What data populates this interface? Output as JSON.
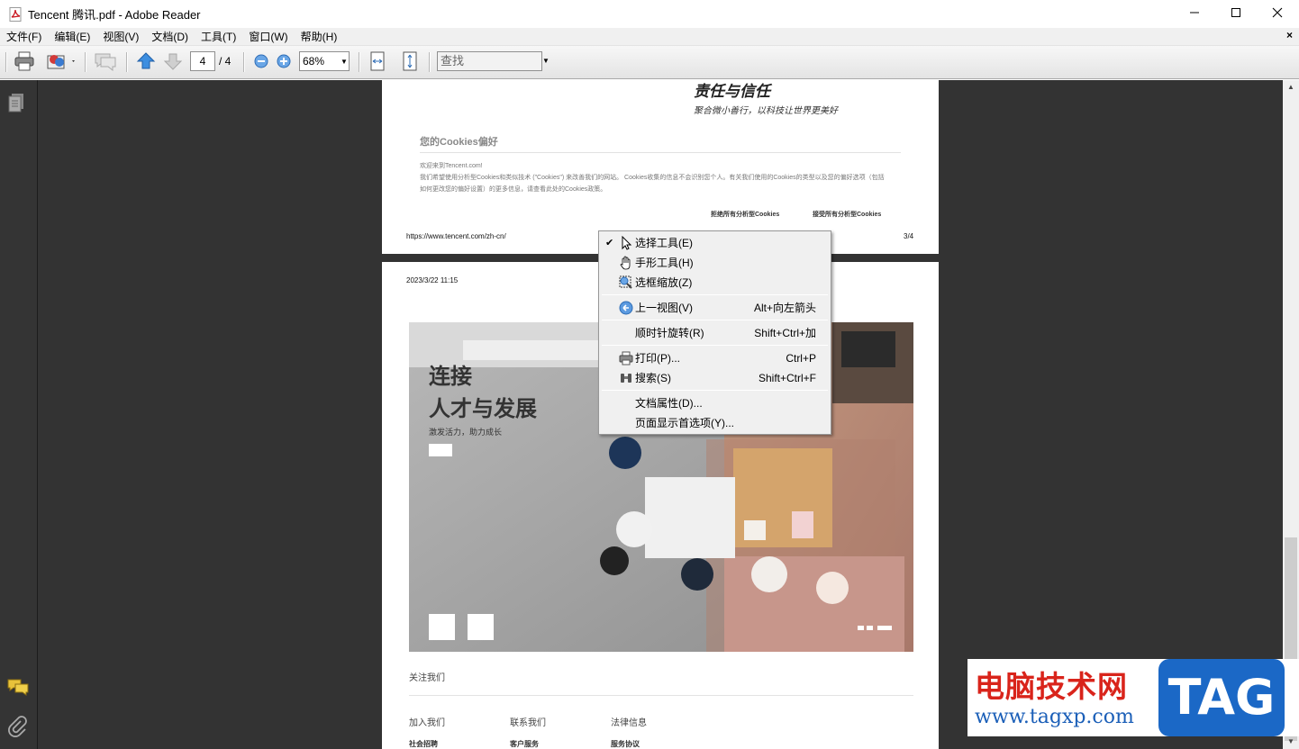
{
  "window": {
    "title": "Tencent 腾讯.pdf - Adobe Reader",
    "icon": "pdf-file-icon",
    "controls": [
      "minimize-icon",
      "maximize-icon",
      "close-icon"
    ]
  },
  "menubar": {
    "items": [
      "文件(F)",
      "编辑(E)",
      "视图(V)",
      "文档(D)",
      "工具(T)",
      "窗口(W)",
      "帮助(H)"
    ],
    "close_doc": "×"
  },
  "toolbar": {
    "current_page": "4",
    "total_pages": "/ 4",
    "zoom": "68%",
    "find_placeholder": "查找",
    "buttons": [
      "print-icon",
      "email-icon",
      "comment-icon",
      "previous-page-icon",
      "next-page-icon",
      "zoom-out-icon",
      "zoom-in-icon",
      "fit-width-icon",
      "fit-page-icon"
    ]
  },
  "leftnav": {
    "icons": [
      "pages-icon",
      "comments-icon",
      "attachments-icon"
    ]
  },
  "page3": {
    "heading": "责任与信任",
    "subheading": "聚合微小善行，以科技让世界更美好",
    "cookie_title": "您的Cookies偏好",
    "cookie_line1": "欢迎来到Tencent.com!",
    "cookie_line2": "我们希望使用分析型Cookies和类似技术 (\"Cookies\") 来改善我们的网站。 Cookies收集的信息不会识别您个人。有关我们使用的Cookies的类型以及您的偏好选项（包括",
    "cookie_line3": "如何更改您的偏好设置）的更多信息，请查看此处的Cookies政策。",
    "reject_btn": "拒绝所有分析型Cookies",
    "accept_btn": "接受所有分析型Cookies",
    "url": "https://www.tencent.com/zh-cn/",
    "page_num": "3/4"
  },
  "page4": {
    "date": "2023/3/22 11:15",
    "hero_line1": "连接",
    "hero_line2": "人才与发展",
    "hero_sub": "激发活力，助力成长",
    "follow": "关注我们",
    "links_col1": "加入我们",
    "links_col2": "联系我们",
    "links_col3": "法律信息",
    "sub_col1": "社会招聘",
    "sub_col2": "客户服务",
    "sub_col3": "服务协议"
  },
  "context_menu": {
    "items": [
      {
        "label": "选择工具(E)",
        "shortcut": "",
        "icon": "arrow-cursor-icon",
        "checked": true
      },
      {
        "label": "手形工具(H)",
        "shortcut": "",
        "icon": "hand-icon",
        "checked": false
      },
      {
        "label": "选框缩放(Z)",
        "shortcut": "",
        "icon": "marquee-zoom-icon",
        "checked": false
      },
      {
        "label": "上一视图(V)",
        "shortcut": "Alt+向左箭头",
        "icon": "previous-view-icon",
        "checked": false
      },
      {
        "label": "顺时针旋转(R)",
        "shortcut": "Shift+Ctrl+加",
        "icon": "",
        "checked": false
      },
      {
        "label": "打印(P)...",
        "shortcut": "Ctrl+P",
        "icon": "print-icon",
        "checked": false
      },
      {
        "label": "搜索(S)",
        "shortcut": "Shift+Ctrl+F",
        "icon": "binoculars-icon",
        "checked": false
      },
      {
        "label": "文档属性(D)...",
        "shortcut": "",
        "icon": "",
        "checked": false
      },
      {
        "label": "页面显示首选项(Y)...",
        "shortcut": "",
        "icon": "",
        "checked": false
      }
    ],
    "check_mark": "✔"
  },
  "watermark": {
    "title": "电脑技术网",
    "url": "www.tagxp.com",
    "badge": "TAG"
  },
  "colors": {
    "doc_background": "#333333",
    "watermark_red": "#d9241b",
    "watermark_blue": "#1b68c6"
  }
}
